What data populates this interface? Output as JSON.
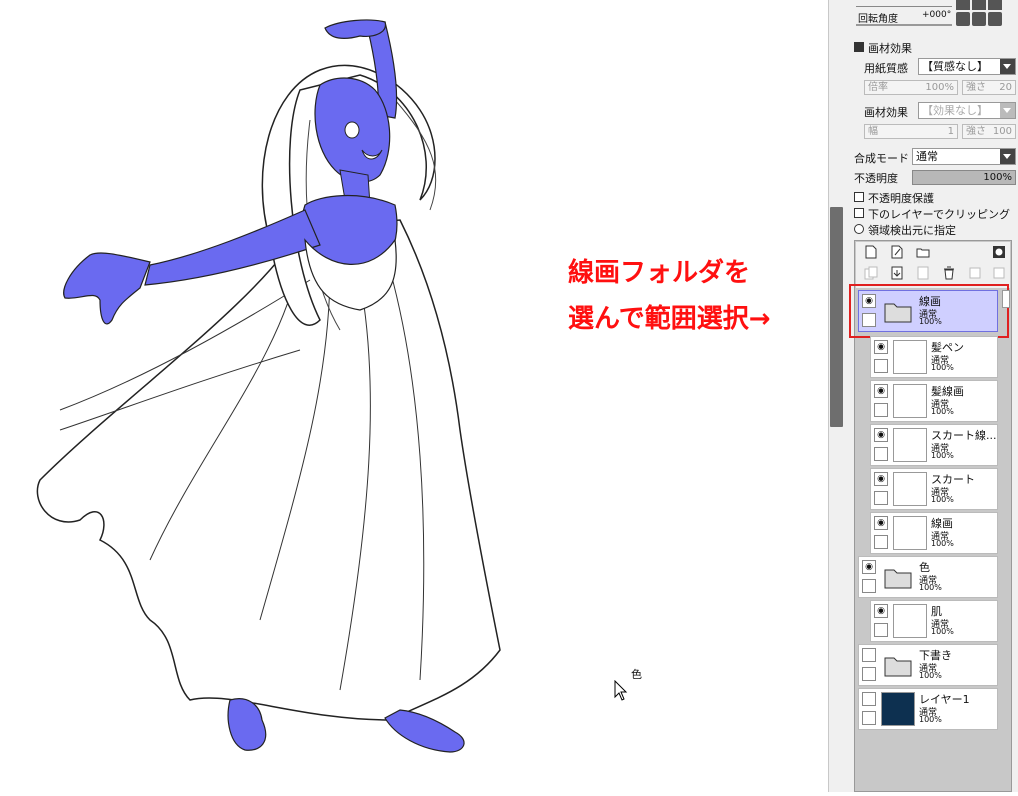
{
  "canvas": {
    "annotation_line1": "線画フォルダを",
    "annotation_line2": "選んで範囲選択→",
    "cursor_label": "色"
  },
  "panel": {
    "rotation_label": "回転角度",
    "rotation_value": "+000°",
    "texture_section": "画材効果",
    "paper_label": "用紙質感",
    "paper_value": "【質感なし】",
    "paper_rate_label": "倍率",
    "paper_rate_value": "100%",
    "paper_strength_label": "強さ",
    "paper_strength_value": "20",
    "effect_label": "画材効果",
    "effect_value": "【効果なし】",
    "effect_width_label": "幅",
    "effect_width_value": "1",
    "effect_strength_label": "強さ",
    "effect_strength_value": "100",
    "blend_label": "合成モード",
    "blend_value": "通常",
    "opacity_label": "不透明度",
    "opacity_value": "100%",
    "protect_opacity": "不透明度保護",
    "clip_lower": "下のレイヤーでクリッピング",
    "selection_source": "領域検出元に指定"
  },
  "layers": [
    {
      "name": "線画",
      "mode": "通常",
      "opacity": "100%"
    },
    {
      "name": "髪ペン",
      "mode": "通常",
      "opacity": "100%"
    },
    {
      "name": "髪線画",
      "mode": "通常",
      "opacity": "100%"
    },
    {
      "name": "スカート線...",
      "mode": "通常",
      "opacity": "100%"
    },
    {
      "name": "スカート",
      "mode": "通常",
      "opacity": "100%"
    },
    {
      "name": "線画",
      "mode": "通常",
      "opacity": "100%"
    },
    {
      "name": "色",
      "mode": "通常",
      "opacity": "100%"
    },
    {
      "name": "肌",
      "mode": "通常",
      "opacity": "100%"
    },
    {
      "name": "下書き",
      "mode": "通常",
      "opacity": "100%"
    },
    {
      "name": "レイヤー1",
      "mode": "通常",
      "opacity": "100%"
    }
  ],
  "colors": {
    "skin_fill": "#6a6af0",
    "annotation": "#ff1010",
    "selected_layer": "#cfcfff",
    "highlight_box": "#e02020",
    "layer1_thumb": "#0d3050"
  }
}
